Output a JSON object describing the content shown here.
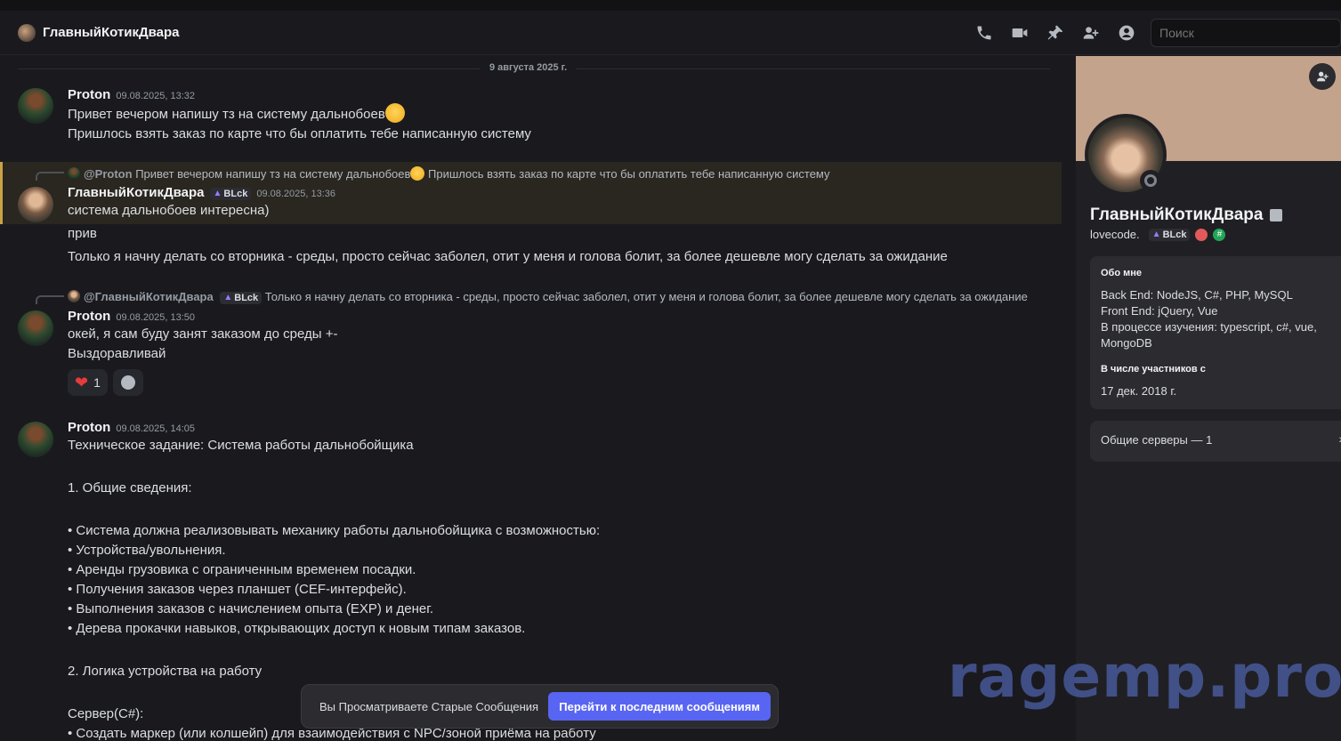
{
  "header": {
    "channel_title": "ГлавныйКотикДвара",
    "search_placeholder": "Поиск",
    "icons": [
      "phone-icon",
      "video-icon",
      "pin-icon",
      "add-member-icon",
      "profile-icon"
    ]
  },
  "chat": {
    "date_divider": "9 августа 2025 г.",
    "messages": [
      {
        "author": "Proton",
        "timestamp": "09.08.2025, 13:32",
        "lines": [
          "Привет вечером напишу тз на систему дальнобоев",
          "Пришлось взять заказ по карте что бы оплатить тебе написанную систему"
        ]
      },
      {
        "reply_mention": "@Proton",
        "reply_text": "Привет вечером напишу тз на систему дальнобоев",
        "reply_text_2": "Пришлось взять заказ по карте что бы оплатить тебе написанную систему",
        "author": "ГлавныйКотикДвара",
        "tag": "BLck",
        "timestamp": "09.08.2025, 13:36",
        "lines": [
          "система дальнобоев интересна)",
          "прив",
          "Только я начну делать со вторника - среды, просто сейчас заболел, отит у меня и голова болит, за более дешевле могу сделать за ожидание"
        ]
      },
      {
        "reply_mention": "@ГлавныйКотикДвара",
        "reply_tag": "BLck",
        "reply_text": "Только я начну делать со вторника - среды, просто сейчас заболел, отит у меня и голова болит, за более дешевле могу сделать за ожидание",
        "author": "Proton",
        "timestamp": "09.08.2025, 13:50",
        "lines": [
          "окей, я сам буду занят заказом до среды +-",
          "Выздоравливай"
        ],
        "reaction_count": "1"
      },
      {
        "author": "Proton",
        "timestamp": "09.08.2025, 14:05",
        "lines": [
          "Техническое задание: Система работы дальнобойщика",
          "1. Общие сведения:",
          "• Система должна реализовывать механику работы дальнобойщика с возможностью:",
          "• Устройства/увольнения.",
          "• Аренды грузовика с ограниченным временем посадки.",
          "• Получения заказов через планшет (CEF-интерфейс).",
          "• Выполнения заказов с начислением опыта (EXP) и денег.",
          "• Дерева прокачки навыков, открывающих доступ к новым типам заказов.",
          "2. Логика устройства на работу",
          "Сервер(C#):",
          "• Создать маркер (или колшейп) для взаимодействия с NPC/зоной приёма на работу"
        ]
      }
    ]
  },
  "profile": {
    "name": "ГлавныйКотикДвара",
    "username": "lovecode.",
    "tag": "BLck",
    "about_title": "Обо мне",
    "about_lines": [
      "Back End: NodeJS, C#, PHP, MySQL",
      "Front End: jQuery, Vue",
      "В процессе изучения: typescript, c#, vue, MongoDB"
    ],
    "member_since_title": "В числе участников с",
    "member_since": "17 дек. 2018 г.",
    "mutual_servers": "Общие серверы — 1"
  },
  "notice": {
    "text": "Вы Просматриваете Старые Сообщения",
    "button": "Перейти к последним сообщениям"
  },
  "watermark": "ragemp.pro"
}
